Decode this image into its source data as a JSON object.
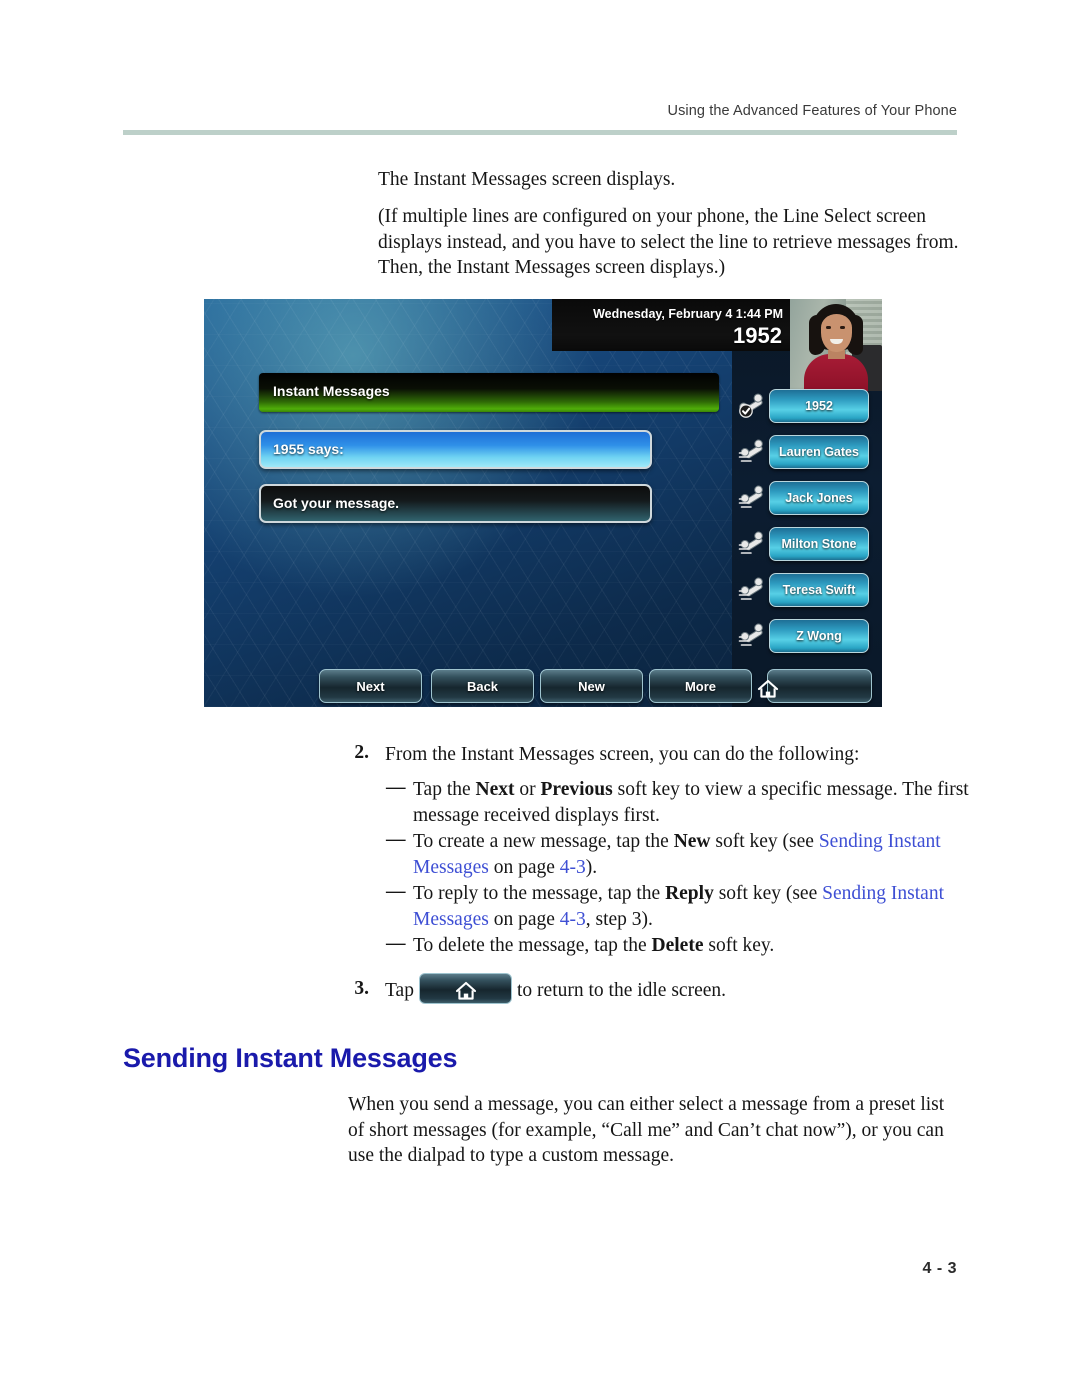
{
  "header": {
    "running_head": "Using the Advanced Features of Your Phone"
  },
  "intro": {
    "paragraph_1": "The Instant Messages screen displays.",
    "paragraph_2": "(If multiple lines are configured on your phone, the Line Select screen displays instead, and you have to select the line to retrieve messages from. Then, the Instant Messages screen displays.)"
  },
  "phone_screen": {
    "status_date": "Wednesday, February 4  1:44 PM",
    "status_extension": "1952",
    "title_bar": "Instant Messages",
    "messages": [
      {
        "label": "1955 says:"
      },
      {
        "label": "Got your message."
      }
    ],
    "line_keys": [
      {
        "label": "1952",
        "icon": "handset-registered-icon"
      },
      {
        "label": "Lauren Gates",
        "icon": "handset-line-icon"
      },
      {
        "label": "Jack Jones",
        "icon": "handset-line-icon"
      },
      {
        "label": "Milton Stone",
        "icon": "handset-line-icon"
      },
      {
        "label": "Teresa Swift",
        "icon": "handset-line-icon"
      },
      {
        "label": "Z Wong",
        "icon": "handset-line-icon"
      }
    ],
    "soft_keys": [
      {
        "label": "Next"
      },
      {
        "label": "Back"
      },
      {
        "label": "New"
      },
      {
        "label": "More"
      }
    ],
    "home_key_icon": "home-icon"
  },
  "steps": {
    "step2": {
      "number": "2.",
      "text": "From the Instant Messages screen, you can do the following:"
    },
    "bullets": [
      {
        "marker": "—",
        "parts": [
          {
            "t": "Tap the ",
            "style": "plain"
          },
          {
            "t": "Next",
            "style": "bold"
          },
          {
            "t": " or ",
            "style": "plain"
          },
          {
            "t": "Previous",
            "style": "bold"
          },
          {
            "t": " soft key to view a specific message. The first message received displays first.",
            "style": "plain"
          }
        ]
      },
      {
        "marker": "—",
        "parts": [
          {
            "t": "To create a new message, tap the ",
            "style": "plain"
          },
          {
            "t": "New",
            "style": "bold"
          },
          {
            "t": " soft key (see ",
            "style": "plain"
          },
          {
            "t": "Sending Instant Messages",
            "style": "xref"
          },
          {
            "t": " on page ",
            "style": "plain"
          },
          {
            "t": "4-3",
            "style": "xref"
          },
          {
            "t": ").",
            "style": "plain"
          }
        ]
      },
      {
        "marker": "—",
        "parts": [
          {
            "t": "To reply to the message, tap the ",
            "style": "plain"
          },
          {
            "t": "Reply",
            "style": "bold"
          },
          {
            "t": " soft key (see ",
            "style": "plain"
          },
          {
            "t": "Sending Instant Messages",
            "style": "xref"
          },
          {
            "t": " on page ",
            "style": "plain"
          },
          {
            "t": "4-3",
            "style": "xref"
          },
          {
            "t": ", step 3).",
            "style": "plain"
          }
        ]
      },
      {
        "marker": "—",
        "parts": [
          {
            "t": "To delete the message, tap the ",
            "style": "plain"
          },
          {
            "t": "Delete",
            "style": "bold"
          },
          {
            "t": " soft key.",
            "style": "plain"
          }
        ]
      }
    ],
    "step3": {
      "number": "3.",
      "text_before": "Tap",
      "text_after": "to return to the idle screen.",
      "button_icon": "home-icon"
    }
  },
  "section": {
    "heading": "Sending Instant Messages",
    "paragraph": "When you send a message, you can either select a message from a preset list of short messages (for example, “Call me” and Can’t chat now”), or you can use the dialpad to type a custom message."
  },
  "footer": {
    "page_number": "4 - 3"
  },
  "colors": {
    "heading_blue": "#1a1aab",
    "xref_blue": "#3e4fd4",
    "header_rule": "#bdd0c9"
  }
}
